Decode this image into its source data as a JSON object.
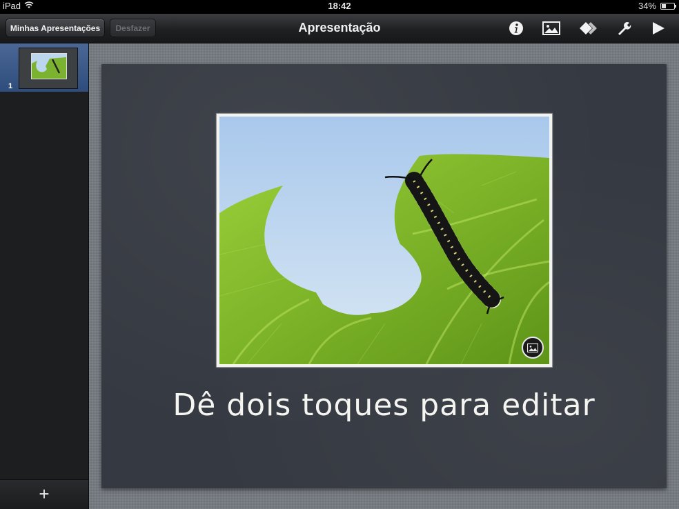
{
  "status_bar": {
    "device": "iPad",
    "time": "18:42",
    "battery": "34%",
    "battery_level": 0.34
  },
  "toolbar": {
    "my_presentations_label": "Minhas Apresentações",
    "undo_label": "Desfazer",
    "title": "Apresentação",
    "icons": [
      "info-icon",
      "media-icon",
      "shapes-icon",
      "tools-icon",
      "play-icon"
    ]
  },
  "sidebar": {
    "slides": [
      {
        "number": "1"
      }
    ],
    "add_label": "+"
  },
  "slide": {
    "caption": "Dê dois toques para editar"
  },
  "colors": {
    "toolbar": "#232427",
    "sidebar": "#1d1e20",
    "selected_thumb": "#3e5c8c",
    "canvas": "#767b82",
    "slide": "#353941",
    "frame": "#f2f2ee"
  }
}
